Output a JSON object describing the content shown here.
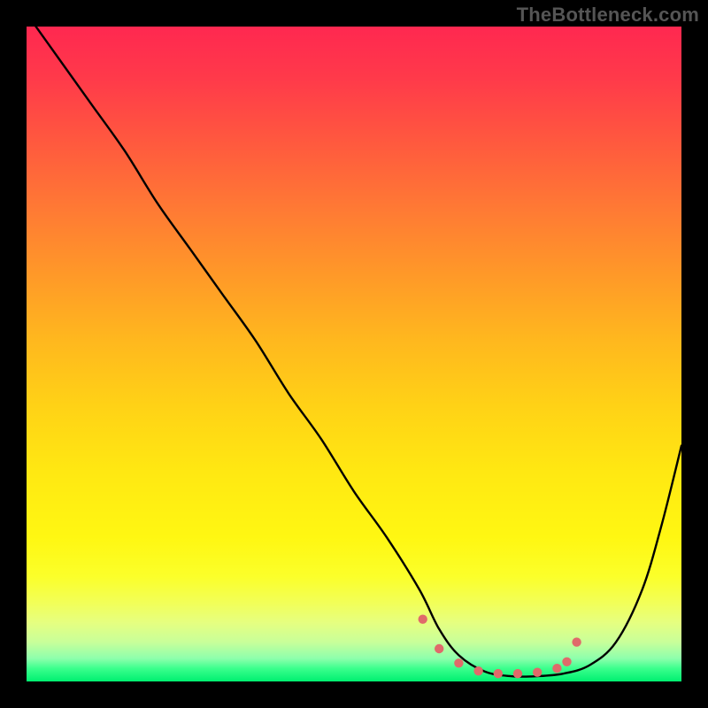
{
  "watermark": "TheBottleneck.com",
  "chart_data": {
    "type": "line",
    "title": "",
    "xlabel": "",
    "ylabel": "",
    "xlim": [
      0,
      100
    ],
    "ylim": [
      0,
      100
    ],
    "gradient_stops": [
      {
        "pct": 0,
        "color": "#ff2850"
      },
      {
        "pct": 8,
        "color": "#ff3a4a"
      },
      {
        "pct": 18,
        "color": "#ff5a3e"
      },
      {
        "pct": 28,
        "color": "#ff7a34"
      },
      {
        "pct": 38,
        "color": "#ff9928"
      },
      {
        "pct": 48,
        "color": "#ffb81e"
      },
      {
        "pct": 58,
        "color": "#ffd216"
      },
      {
        "pct": 68,
        "color": "#ffe812"
      },
      {
        "pct": 78,
        "color": "#fff712"
      },
      {
        "pct": 84,
        "color": "#fbff2a"
      },
      {
        "pct": 88,
        "color": "#f2ff58"
      },
      {
        "pct": 91,
        "color": "#e6ff80"
      },
      {
        "pct": 94,
        "color": "#c8ff9a"
      },
      {
        "pct": 96.5,
        "color": "#8dffac"
      },
      {
        "pct": 98,
        "color": "#3bff8d"
      },
      {
        "pct": 100,
        "color": "#00f070"
      }
    ],
    "series": [
      {
        "name": "bottleneck-curve",
        "x": [
          0,
          5,
          10,
          15,
          20,
          25,
          30,
          35,
          40,
          45,
          50,
          55,
          60,
          63,
          66,
          70,
          74,
          78,
          82,
          86,
          90,
          94,
          97,
          100
        ],
        "values": [
          102,
          95,
          88,
          81,
          73,
          66,
          59,
          52,
          44,
          37,
          29,
          22,
          14,
          8,
          4,
          1.5,
          0.8,
          0.8,
          1.2,
          2.5,
          6,
          14,
          24,
          36
        ]
      }
    ],
    "markers": {
      "name": "valley-dots",
      "color": "#e06a6a",
      "points": [
        {
          "x": 60.5,
          "y": 9.5
        },
        {
          "x": 63.0,
          "y": 5.0
        },
        {
          "x": 66.0,
          "y": 2.8
        },
        {
          "x": 69.0,
          "y": 1.6
        },
        {
          "x": 72.0,
          "y": 1.2
        },
        {
          "x": 75.0,
          "y": 1.2
        },
        {
          "x": 78.0,
          "y": 1.4
        },
        {
          "x": 81.0,
          "y": 2.0
        },
        {
          "x": 82.5,
          "y": 3.0
        },
        {
          "x": 84.0,
          "y": 6.0
        }
      ]
    }
  }
}
